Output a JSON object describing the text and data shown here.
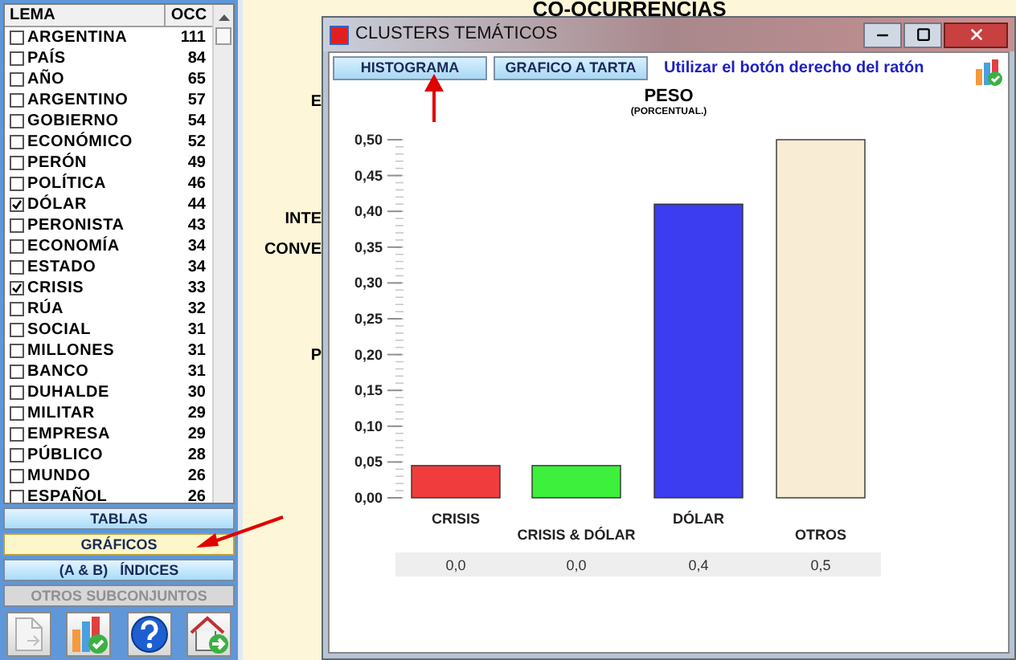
{
  "left_panel": {
    "list": {
      "columns": [
        "LEMA",
        "OCC"
      ],
      "rows": [
        {
          "lema": "ARGENTINA",
          "occ": "111",
          "checked": false
        },
        {
          "lema": "PAÍS",
          "occ": "84",
          "checked": false
        },
        {
          "lema": "AÑO",
          "occ": "65",
          "checked": false
        },
        {
          "lema": "ARGENTINO",
          "occ": "57",
          "checked": false
        },
        {
          "lema": "GOBIERNO",
          "occ": "54",
          "checked": false
        },
        {
          "lema": "ECONÓMICO",
          "occ": "52",
          "checked": false
        },
        {
          "lema": "PERÓN",
          "occ": "49",
          "checked": false
        },
        {
          "lema": "POLÍTICA",
          "occ": "46",
          "checked": false
        },
        {
          "lema": "DÓLAR",
          "occ": "44",
          "checked": true
        },
        {
          "lema": "PERONISTA",
          "occ": "43",
          "checked": false
        },
        {
          "lema": "ECONOMÍA",
          "occ": "34",
          "checked": false
        },
        {
          "lema": "ESTADO",
          "occ": "34",
          "checked": false
        },
        {
          "lema": "CRISIS",
          "occ": "33",
          "checked": true
        },
        {
          "lema": "RÚA",
          "occ": "32",
          "checked": false
        },
        {
          "lema": "SOCIAL",
          "occ": "31",
          "checked": false
        },
        {
          "lema": "MILLONES",
          "occ": "31",
          "checked": false
        },
        {
          "lema": "BANCO",
          "occ": "31",
          "checked": false
        },
        {
          "lema": "DUHALDE",
          "occ": "30",
          "checked": false
        },
        {
          "lema": "MILITAR",
          "occ": "29",
          "checked": false
        },
        {
          "lema": "EMPRESA",
          "occ": "29",
          "checked": false
        },
        {
          "lema": "PÚBLICO",
          "occ": "28",
          "checked": false
        },
        {
          "lema": "MUNDO",
          "occ": "26",
          "checked": false
        },
        {
          "lema": "ESPAÑOL",
          "occ": "26",
          "checked": false
        }
      ]
    },
    "buttons": [
      {
        "label": "TABLAS",
        "selected": false,
        "disabled": false
      },
      {
        "label": "GRÁFICOS",
        "selected": true,
        "disabled": false
      },
      {
        "label": "(A & B)   ÍNDICES",
        "selected": false,
        "disabled": false
      },
      {
        "label": "OTROS SUBCONJUNTOS",
        "selected": false,
        "disabled": true
      }
    ],
    "icon_buttons": [
      {
        "kind": "document"
      },
      {
        "kind": "chart"
      },
      {
        "kind": "help"
      },
      {
        "kind": "home"
      }
    ]
  },
  "background": {
    "title": "CO-OCURRENCIAS",
    "labels": [
      "E",
      "INTE",
      "CONVE",
      "P"
    ]
  },
  "window": {
    "title": "CLUSTERS TEMÁTICOS",
    "tabs": [
      "HISTOGRAMA",
      "GRAFICO A TARTA"
    ],
    "hint": "Utilizar el botón derecho del ratón",
    "chart": {
      "subtitle": "(PORCENTUAL.)",
      "bars": [
        {
          "color": "#f03c3c"
        },
        {
          "color": "#3cf03c"
        },
        {
          "color": "#3c3cf0"
        },
        {
          "color": "#f8ecd4"
        }
      ],
      "chart_data": {
        "type": "bar",
        "title": "PESO",
        "categories": [
          "CRISIS",
          "CRISIS & DÓLAR",
          "DÓLAR",
          "OTROS"
        ],
        "series": [
          {
            "values": [
              0.045,
              0.045,
              0.41,
              0.5
            ]
          }
        ],
        "ylim": [
          0,
          0.5
        ],
        "yticks": [
          {
            "value": 0,
            "label": "0,00"
          },
          {
            "value": 0.05,
            "label": "0,05"
          },
          {
            "value": 0.1,
            "label": "0,10"
          },
          {
            "value": 0.15,
            "label": "0,15"
          },
          {
            "value": 0.2,
            "label": "0,20"
          },
          {
            "value": 0.25,
            "label": "0,25"
          },
          {
            "value": 0.3,
            "label": "0,30"
          },
          {
            "value": 0.35,
            "label": "0,35"
          },
          {
            "value": 0.4,
            "label": "0,40"
          },
          {
            "value": 0.45,
            "label": "0,45"
          },
          {
            "value": 0.5,
            "label": "0,50"
          }
        ],
        "value_labels": [
          "0,0",
          "0,0",
          "0,4",
          "0,5"
        ]
      }
    }
  }
}
